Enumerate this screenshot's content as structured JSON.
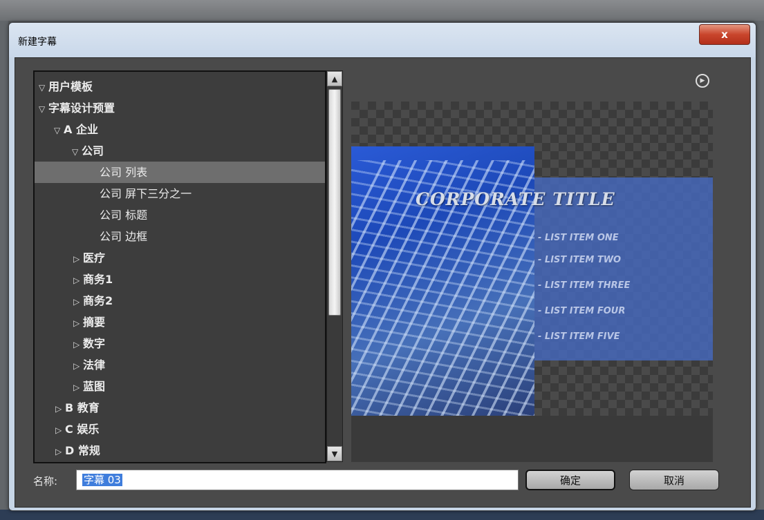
{
  "dialog": {
    "title": "新建字幕",
    "close_label": "x"
  },
  "tree": {
    "items": [
      {
        "label": "用户模板",
        "expander": "▽",
        "bold": true,
        "selected": false
      },
      {
        "label": "字幕设计预置",
        "expander": "▽",
        "bold": true,
        "selected": false
      },
      {
        "label": "A 企业",
        "expander": "▽",
        "bold": true,
        "selected": false
      },
      {
        "label": "公司",
        "expander": "▽",
        "bold": true,
        "selected": false
      },
      {
        "label": "公司 列表",
        "expander": "",
        "bold": false,
        "selected": true
      },
      {
        "label": "公司 屏下三分之一",
        "expander": "",
        "bold": false,
        "selected": false
      },
      {
        "label": "公司 标题",
        "expander": "",
        "bold": false,
        "selected": false
      },
      {
        "label": "公司 边框",
        "expander": "",
        "bold": false,
        "selected": false
      },
      {
        "label": "医疗",
        "expander": "▷",
        "bold": true,
        "selected": false
      },
      {
        "label": "商务1",
        "expander": "▷",
        "bold": true,
        "selected": false
      },
      {
        "label": "商务2",
        "expander": "▷",
        "bold": true,
        "selected": false
      },
      {
        "label": "摘要",
        "expander": "▷",
        "bold": true,
        "selected": false
      },
      {
        "label": "数字",
        "expander": "▷",
        "bold": true,
        "selected": false
      },
      {
        "label": "法律",
        "expander": "▷",
        "bold": true,
        "selected": false
      },
      {
        "label": "蓝图",
        "expander": "▷",
        "bold": true,
        "selected": false
      },
      {
        "label": "B 教育",
        "expander": "▷",
        "bold": true,
        "selected": false
      },
      {
        "label": "C 娱乐",
        "expander": "▷",
        "bold": true,
        "selected": false
      },
      {
        "label": "D 常规",
        "expander": "▷",
        "bold": true,
        "selected": false
      }
    ]
  },
  "preview": {
    "title": "CORPORATE TITLE",
    "list_items": [
      "- LIST ITEM ONE",
      "- LIST ITEM TWO",
      "- LIST ITEM THREE",
      "- LIST ITEM FOUR",
      "- LIST ITEM FIVE"
    ]
  },
  "name_field": {
    "label": "名称:",
    "value": "字幕 03"
  },
  "buttons": {
    "ok": "确定",
    "cancel": "取消"
  },
  "colors": {
    "selection": "#3f7ddc",
    "tree_background": "#3d3d3d",
    "close_button": "#c9452c"
  }
}
